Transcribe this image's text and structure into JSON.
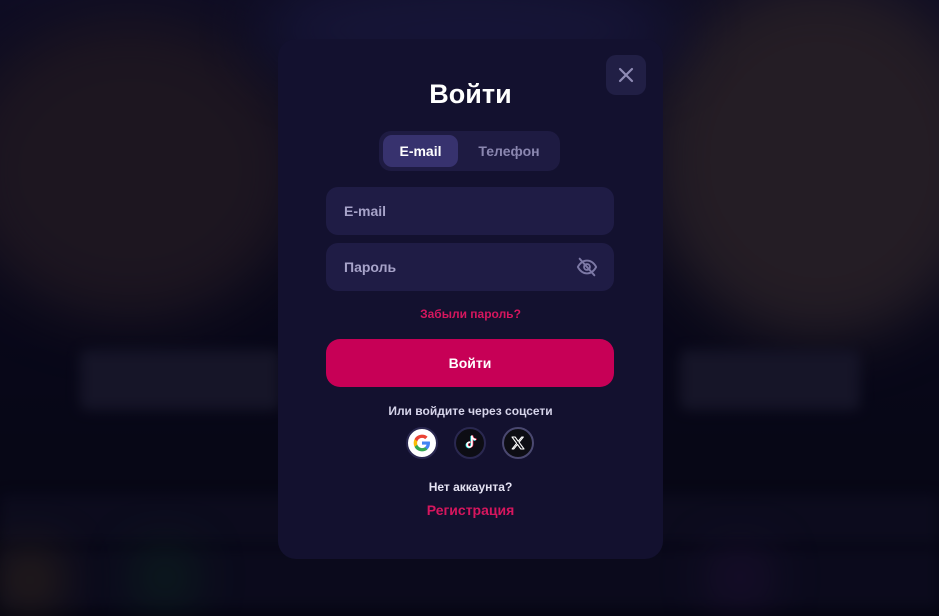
{
  "modal": {
    "title": "Войти",
    "close_icon": "close-icon",
    "tabs": [
      {
        "label": "E-mail",
        "active": true
      },
      {
        "label": "Телефон",
        "active": false
      }
    ],
    "email_field": {
      "placeholder": "E-mail",
      "value": ""
    },
    "password_field": {
      "placeholder": "Пароль",
      "value": "",
      "toggle_icon": "eye-off-icon"
    },
    "forgot_link": "Забыли пароль?",
    "login_button": "Войти",
    "social_prompt": "Или войдите через соцсети",
    "socials": [
      "google-icon",
      "tiktok-icon",
      "x-icon"
    ],
    "no_account_text": "Нет аккаунта?",
    "register_link": "Регистрация"
  },
  "colors": {
    "modal_bg": "#13112f",
    "accent": "#c70056",
    "link": "#d6165e",
    "field_bg": "#1f1c45",
    "tab_active_bg": "#37326e"
  }
}
